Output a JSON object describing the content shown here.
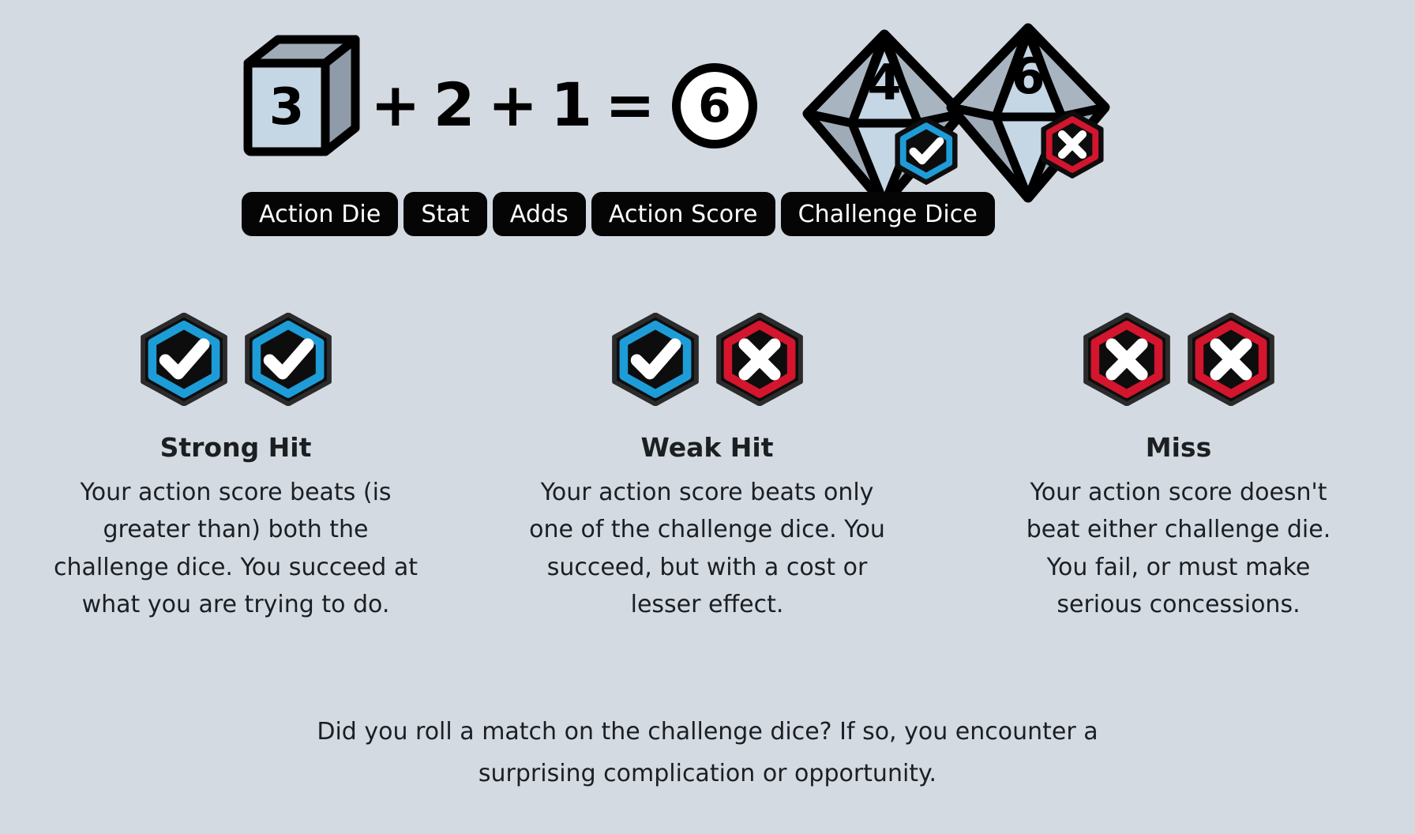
{
  "colors": {
    "background": "#d4dae2",
    "ink": "#1b1f22",
    "pill_bg": "#050505",
    "blue": "#1e9cd7",
    "red": "#d3152e",
    "die_face_light": "#c5d6e5",
    "die_face_mid": "#9fabb7",
    "die_face_dark": "#8f9ba8",
    "white": "#ffffff"
  },
  "equation": {
    "action_die": {
      "icon": "d6-die-icon",
      "value": "3"
    },
    "plus_1": "+",
    "stat_value": "2",
    "plus_2": "+",
    "adds_value": "1",
    "equals": "=",
    "action_score": {
      "icon": "circle-score-icon",
      "value": "6"
    },
    "challenge_dice": [
      {
        "icon": "d10-die-icon",
        "value": "4",
        "badge": "check-hex-icon",
        "badge_color": "#1e9cd7"
      },
      {
        "icon": "d10-die-icon",
        "value": "6",
        "badge": "cross-hex-icon",
        "badge_color": "#d3152e"
      }
    ]
  },
  "pills": [
    {
      "label": "Action Die"
    },
    {
      "label": "Stat"
    },
    {
      "label": "Adds"
    },
    {
      "label": "Action Score"
    },
    {
      "label": "Challenge Dice"
    }
  ],
  "outcomes": [
    {
      "title": "Strong Hit",
      "description": "Your action score beats (is greater than) both the challenge dice. You succeed at what you are trying to do.",
      "badges": [
        {
          "icon": "check-hex-icon",
          "result": "check",
          "color": "#1e9cd7"
        },
        {
          "icon": "check-hex-icon",
          "result": "check",
          "color": "#1e9cd7"
        }
      ]
    },
    {
      "title": "Weak Hit",
      "description": "Your action score beats only one of the challenge dice. You succeed, but with a cost or lesser effect.",
      "badges": [
        {
          "icon": "check-hex-icon",
          "result": "check",
          "color": "#1e9cd7"
        },
        {
          "icon": "cross-hex-icon",
          "result": "cross",
          "color": "#d3152e"
        }
      ]
    },
    {
      "title": "Miss",
      "description": "Your action score doesn't beat either challenge die. You fail, or must make serious concessions.",
      "badges": [
        {
          "icon": "cross-hex-icon",
          "result": "cross",
          "color": "#d3152e"
        },
        {
          "icon": "cross-hex-icon",
          "result": "cross",
          "color": "#d3152e"
        }
      ]
    }
  ],
  "footer": {
    "line1": "Did you roll a match on the challenge dice? If so, you encounter a",
    "line2": "surprising complication or opportunity."
  }
}
